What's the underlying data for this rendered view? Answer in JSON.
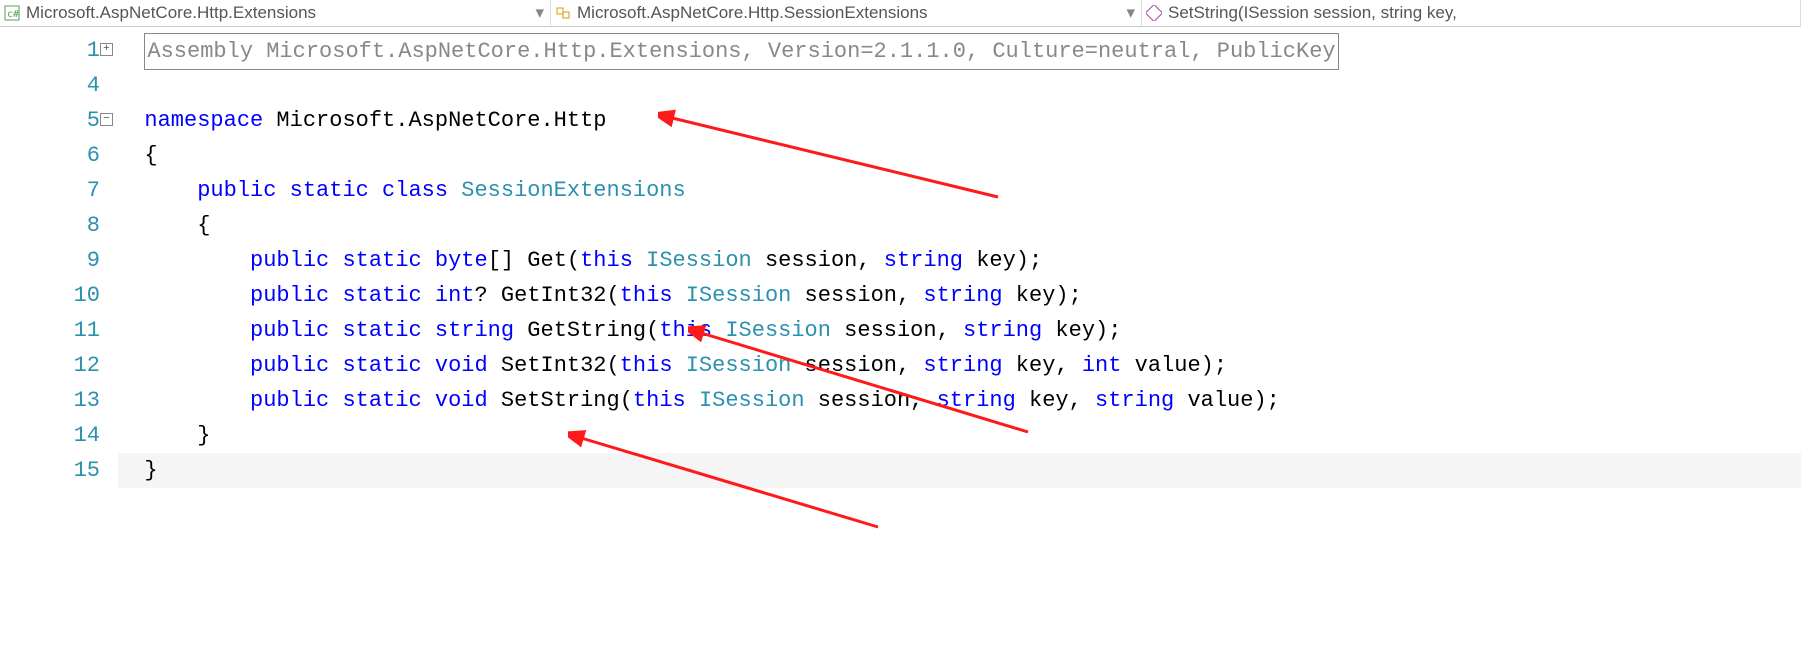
{
  "nav": {
    "left": "Microsoft.AspNetCore.Http.Extensions",
    "middle": "Microsoft.AspNetCore.Http.SessionExtensions",
    "right": "SetString(ISession session, string key,"
  },
  "gutter": [
    "1",
    "4",
    "5",
    "6",
    "7",
    "8",
    "9",
    "10",
    "11",
    "12",
    "13",
    "14",
    "15"
  ],
  "code": {
    "asm": "Assembly Microsoft.AspNetCore.Http.Extensions, Version=2.1.1.0, Culture=neutral, PublicKey",
    "ns_kw": "namespace",
    "ns_name": " Microsoft.AspNetCore.Http",
    "ob": "{",
    "cb": "}",
    "cls_mods": "public static class ",
    "cls_name": "SessionExtensions",
    "m1a": "public static ",
    "m1b": "byte",
    "m1c": "[] Get(",
    "m1d": "this ",
    "m1e": "ISession",
    "m1f": " session, ",
    "m1g": "string",
    "m1h": " key);",
    "m2a": "public static ",
    "m2b": "int",
    "m2c": "? GetInt32(",
    "m2d": "this ",
    "m2e": "ISession",
    "m2f": " session, ",
    "m2g": "string",
    "m2h": " key);",
    "m3a": "public static ",
    "m3b": "string",
    "m3c": " GetString(",
    "m3d": "this ",
    "m3e": "ISession",
    "m3f": " session, ",
    "m3g": "string",
    "m3h": " key);",
    "m4a": "public static ",
    "m4b": "void",
    "m4c": " SetInt32(",
    "m4d": "this ",
    "m4e": "ISession",
    "m4f": " session, ",
    "m4g": "string",
    "m4h": " key, ",
    "m4i": "int",
    "m4j": " value);",
    "m5a": "public static ",
    "m5b": "void",
    "m5c": " SetString(",
    "m5d": "this ",
    "m5e": "ISession",
    "m5f": " session, ",
    "m5g": "string",
    "m5h": " key, ",
    "m5i": "string",
    "m5j": " value);"
  },
  "fold": {
    "plus": "+",
    "minus": "−"
  }
}
